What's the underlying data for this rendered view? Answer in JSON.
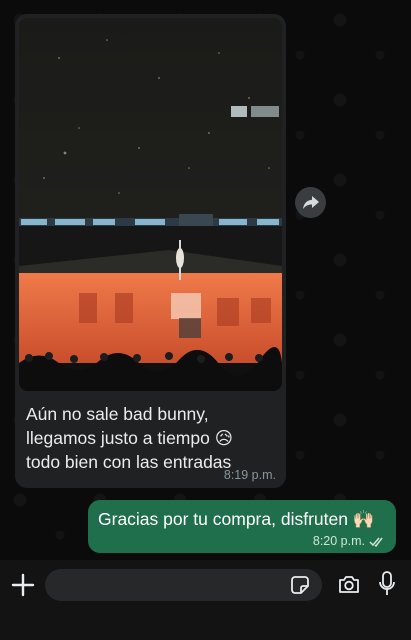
{
  "messages": {
    "incoming": {
      "caption": "Aún no sale bad bunny,\nllegamos justo a tiempo 😥\ntodo bien con las entradas",
      "time": "8:19 p.m."
    },
    "outgoing": {
      "text": "Gracias por tu compra, disfruten 🙌🏻",
      "time": "8:20 p.m."
    }
  },
  "composer": {
    "placeholder": ""
  },
  "icons": {
    "forward": "forward-arrow-icon",
    "plus": "plus-icon",
    "sticker": "sticker-icon",
    "camera": "camera-icon",
    "mic": "microphone-icon",
    "read_receipt": "double-check-icon"
  },
  "colors": {
    "incoming_bubble": "#1f2122",
    "outgoing_bubble": "#1f6f4c",
    "background": "#0b0b0b",
    "stage_glow": "#e0643a"
  }
}
